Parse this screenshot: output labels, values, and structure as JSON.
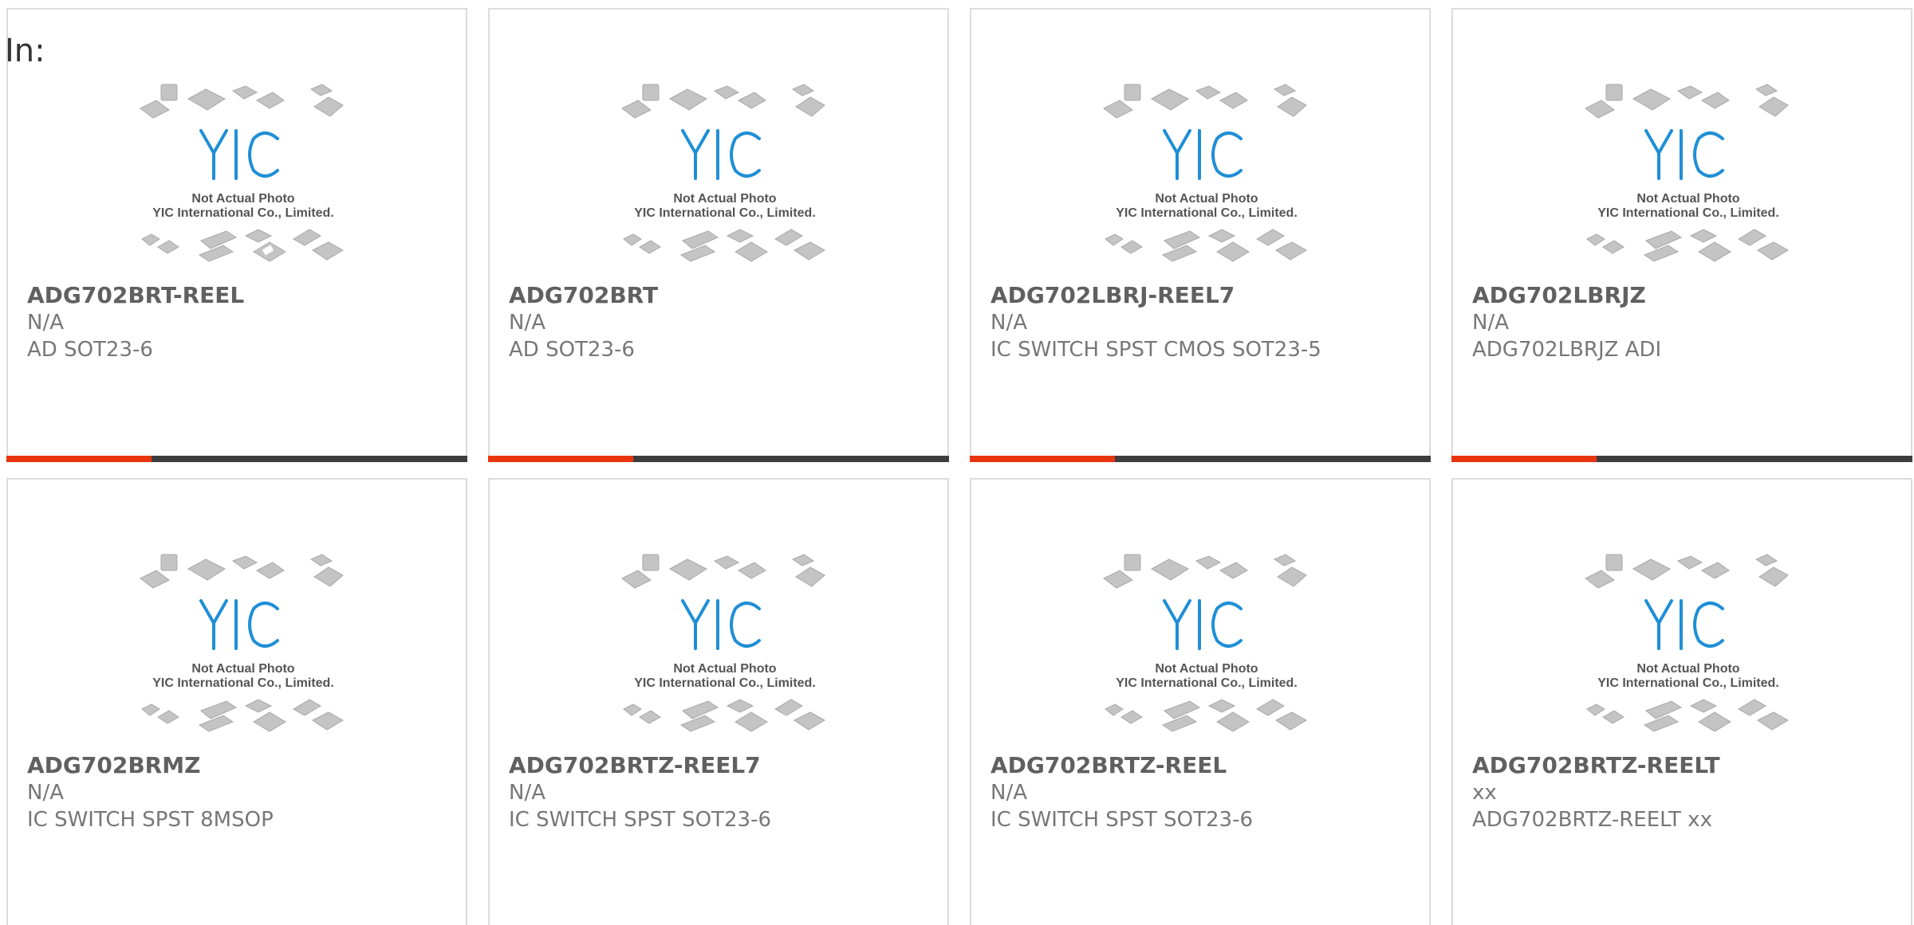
{
  "page": {
    "prefix": "In:"
  },
  "colors": {
    "accent": "#e8350f",
    "bar": "#3d3d3d",
    "logo_blue": "#1f8fd6"
  },
  "placeholder_image": {
    "line1": "Not Actual Photo",
    "line2": "YIC International Co., Limited."
  },
  "products": [
    {
      "part": "ADG702BRT-REEL",
      "mfr": "N/A",
      "desc": "AD SOT23-6"
    },
    {
      "part": "ADG702BRT",
      "mfr": "N/A",
      "desc": "AD SOT23-6"
    },
    {
      "part": "ADG702LBRJ-REEL7",
      "mfr": "N/A",
      "desc": "IC SWITCH SPST CMOS SOT23-5"
    },
    {
      "part": "ADG702LBRJZ",
      "mfr": "N/A",
      "desc": "ADG702LBRJZ ADI"
    },
    {
      "part": "ADG702BRMZ",
      "mfr": "N/A",
      "desc": "IC SWITCH SPST 8MSOP"
    },
    {
      "part": "ADG702BRTZ-REEL7",
      "mfr": "N/A",
      "desc": "IC SWITCH SPST SOT23-6"
    },
    {
      "part": "ADG702BRTZ-REEL",
      "mfr": "N/A",
      "desc": "IC SWITCH SPST SOT23-6"
    },
    {
      "part": "ADG702BRTZ-REELT",
      "mfr": "xx",
      "desc": "ADG702BRTZ-REELT xx"
    }
  ]
}
